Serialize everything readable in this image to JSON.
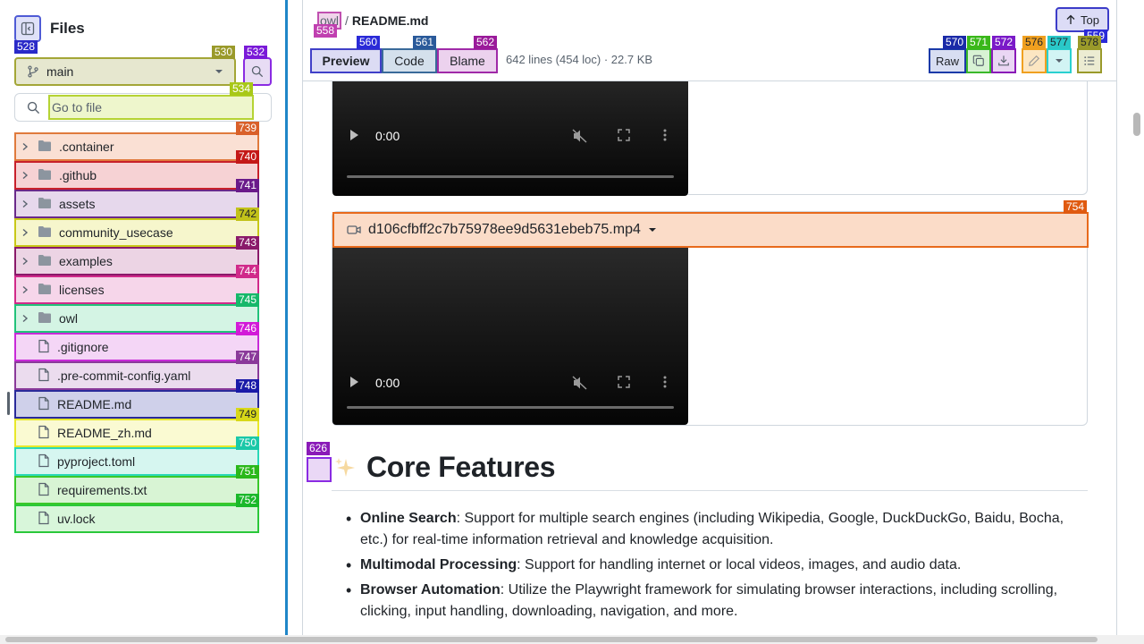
{
  "sidebar": {
    "title": "Files",
    "branch": "main",
    "goto_placeholder": "Go to file",
    "items": [
      {
        "name": ".container",
        "type": "folder",
        "tag": "739",
        "border": "#e07a3c",
        "bg": "#fae0d4",
        "tagbg": "#d9602a"
      },
      {
        "name": ".github",
        "type": "folder",
        "tag": "740",
        "border": "#c8202a",
        "bg": "#f6d2d4",
        "tagbg": "#c41818"
      },
      {
        "name": "assets",
        "type": "folder",
        "tag": "741",
        "border": "#6a2a8a",
        "bg": "#e6d8ec",
        "tagbg": "#6a1a8a"
      },
      {
        "name": "community_usecase",
        "type": "folder",
        "tag": "742",
        "border": "#c8c818",
        "bg": "#f6f6cc",
        "tagbg": "#c2c21a"
      },
      {
        "name": "examples",
        "type": "folder",
        "tag": "743",
        "border": "#8a1a6a",
        "bg": "#ecd4e4",
        "tagbg": "#8a1a6a"
      },
      {
        "name": "licenses",
        "type": "folder",
        "tag": "744",
        "border": "#d02a8a",
        "bg": "#f6d6ea",
        "tagbg": "#d02a8a"
      },
      {
        "name": "owl",
        "type": "folder",
        "tag": "745",
        "border": "#22c27a",
        "bg": "#d4f4e4",
        "tagbg": "#16b86a"
      },
      {
        "name": ".gitignore",
        "type": "file",
        "tag": "746",
        "border": "#c82ad8",
        "bg": "#f4d6f6",
        "tagbg": "#d21ad8"
      },
      {
        "name": ".pre-commit-config.yaml",
        "type": "file",
        "tag": "747",
        "border": "#8a3a9a",
        "bg": "#ebdcee",
        "tagbg": "#8a3a9a"
      },
      {
        "name": "README.md",
        "type": "file",
        "tag": "748",
        "border": "#2a2a9a",
        "bg": "#cfd0ea",
        "tagbg": "#1a1aa8"
      },
      {
        "name": "README_zh.md",
        "type": "file",
        "tag": "749",
        "border": "#e8e82a",
        "bg": "#fafad2",
        "tagbg": "#d8d818"
      },
      {
        "name": "pyproject.toml",
        "type": "file",
        "tag": "750",
        "border": "#2ad8b8",
        "bg": "#d6f6f0",
        "tagbg": "#1ac8a8"
      },
      {
        "name": "requirements.txt",
        "type": "file",
        "tag": "751",
        "border": "#3ac82a",
        "bg": "#d8f4d4",
        "tagbg": "#2ab81a"
      },
      {
        "name": "uv.lock",
        "type": "file",
        "tag": "752",
        "border": "#2ac83a",
        "bg": "#d8f6da",
        "tagbg": "#1ab82a"
      }
    ]
  },
  "tags": {
    "collapse": "528",
    "branch": "530",
    "search": "532",
    "goto": "534",
    "crumb": "558",
    "preview": "560",
    "code": "561",
    "blame": "562",
    "raw": "570",
    "copy": "571",
    "download": "572",
    "edit": "576",
    "more": "577",
    "outline": "578",
    "top": "559",
    "video": "754",
    "anchor": "626"
  },
  "header": {
    "crumb_repo": "owl",
    "crumb_sep": "/",
    "crumb_file": "README.md",
    "top_label": "Top",
    "tabs": {
      "preview": "Preview",
      "code": "Code",
      "blame": "Blame"
    },
    "meta": "642 lines (454 loc) · 22.7 KB",
    "raw_label": "Raw"
  },
  "videos": [
    {
      "time": "0:00"
    },
    {
      "filename": "d106cfbff2c7b75978ee9d5631ebeb75.mp4",
      "time": "0:00"
    }
  ],
  "section": {
    "heading": "Core Features",
    "items": [
      {
        "bold": "Online Search",
        "text": ": Support for multiple search engines (including Wikipedia, Google, DuckDuckGo, Baidu, Bocha, etc.) for real-time information retrieval and knowledge acquisition."
      },
      {
        "bold": "Multimodal Processing",
        "text": ": Support for handling internet or local videos, images, and audio data."
      },
      {
        "bold": "Browser Automation",
        "text": ": Utilize the Playwright framework for simulating browser interactions, including scrolling, clicking, input handling, downloading, navigation, and more."
      }
    ]
  }
}
